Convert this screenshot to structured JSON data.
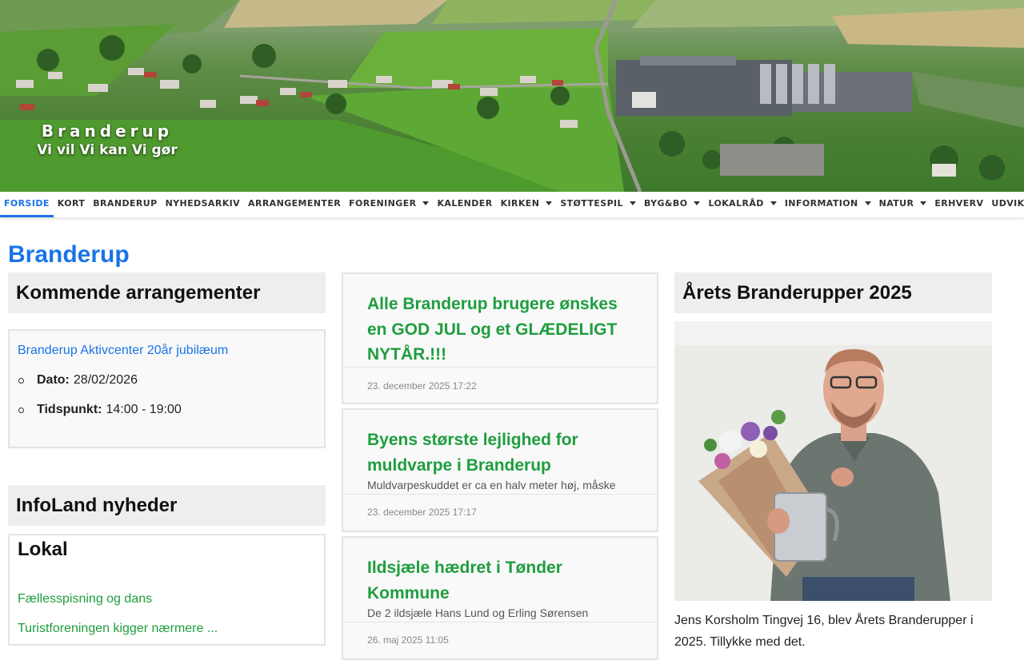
{
  "header": {
    "title_line1": "Branderup",
    "title_line2": "Vi vil Vi kan Vi gør"
  },
  "nav": {
    "items": [
      {
        "label": "FORSIDE",
        "active": true,
        "dropdown": false
      },
      {
        "label": "KORT",
        "dropdown": false
      },
      {
        "label": "BRANDERUP",
        "dropdown": false
      },
      {
        "label": "NYHEDSARKIV",
        "dropdown": false
      },
      {
        "label": "ARRANGEMENTER",
        "dropdown": false
      },
      {
        "label": "FORENINGER",
        "dropdown": true
      },
      {
        "label": "KALENDER",
        "dropdown": false
      },
      {
        "label": "KIRKEN",
        "dropdown": true
      },
      {
        "label": "STØTTESPIL",
        "dropdown": true
      },
      {
        "label": "BYG&BO",
        "dropdown": true
      },
      {
        "label": "LOKALRÅD",
        "dropdown": true
      },
      {
        "label": "INFORMATION",
        "dropdown": true
      },
      {
        "label": "NATUR",
        "dropdown": true
      },
      {
        "label": "ERHVERV",
        "dropdown": false
      },
      {
        "label": "UDVIKLING",
        "dropdown": true
      }
    ]
  },
  "page": {
    "title": "Branderup"
  },
  "events": {
    "heading": "Kommende arrangementer",
    "title": "Branderup Aktivcenter 20år jubilæum",
    "date_label": "Dato:",
    "date_value": "28/02/2026",
    "time_label": "Tidspunkt:",
    "time_value": "14:00 - 19:00"
  },
  "infoland": {
    "heading": "InfoLand nyheder",
    "subheading": "Lokal",
    "links": [
      "Fællesspisning og dans",
      "Turistforeningen kigger nærmere ..."
    ]
  },
  "posts": [
    {
      "title": "Alle Branderup brugere ønskes en GOD JUL og et GLÆDELIGT NYTÅR.!!!",
      "excerpt": "",
      "date": "23. december 2025 17:22"
    },
    {
      "title": "Byens største lejlighed for muldvarpe i Branderup",
      "excerpt": "Muldvarpeskuddet er ca en halv meter høj, måske",
      "date": "23. december 2025 17:17"
    },
    {
      "title": "Ildsjæle hædret i Tønder Kommune",
      "excerpt": "De 2 ildsjæle Hans Lund og Erling Sørensen",
      "date": "26. maj 2025 11:05"
    }
  ],
  "award": {
    "heading": "Årets Branderupper 2025",
    "caption": "Jens Korsholm Tingvej 16, blev Årets Branderupper i 2025. Tillykke med det."
  },
  "colors": {
    "accent_blue": "#1a73e8",
    "link_green": "#1e9e3e",
    "panel_grey": "#eeeeee"
  }
}
